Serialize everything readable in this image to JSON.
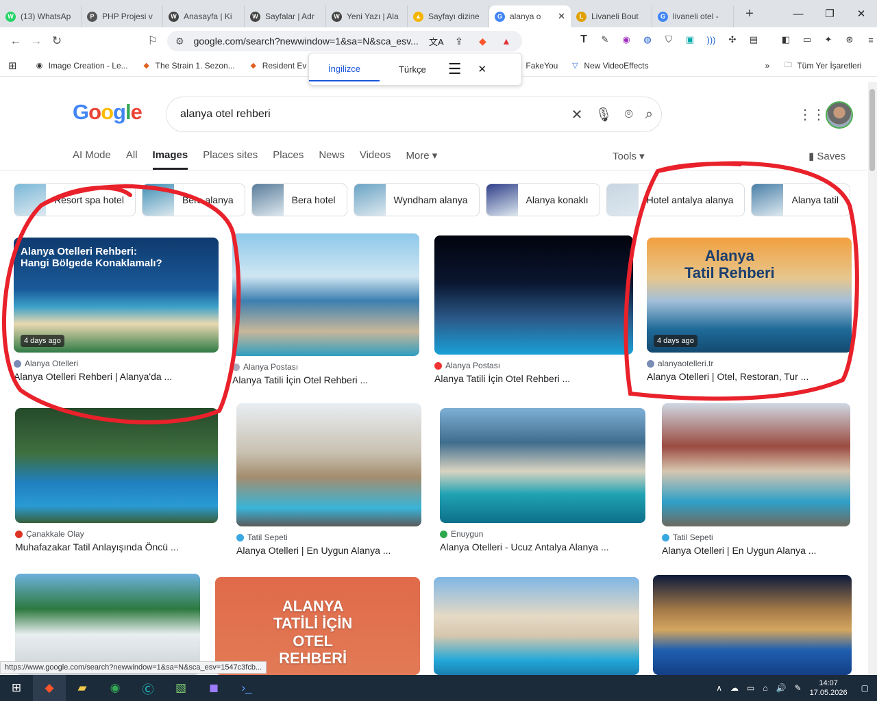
{
  "tabs": [
    {
      "title": "(13) WhatsAp",
      "color": "#25d366",
      "glyph": "W"
    },
    {
      "title": "PHP Projesi v",
      "color": "#555",
      "glyph": "P"
    },
    {
      "title": "Anasayfa | Ki",
      "color": "#444",
      "glyph": "W"
    },
    {
      "title": "Sayfalar | Adr",
      "color": "#444",
      "glyph": "W"
    },
    {
      "title": "Yeni Yazı | Ala",
      "color": "#444",
      "glyph": "W"
    },
    {
      "title": "Sayfayı dizine",
      "color": "#f4b400",
      "glyph": "▲"
    },
    {
      "title": "alanya o",
      "color": "#4285f4",
      "glyph": "G"
    },
    {
      "title": "Livaneli Bout",
      "color": "#e0a000",
      "glyph": "L"
    },
    {
      "title": "livaneli otel -",
      "color": "#4285f4",
      "glyph": "G"
    }
  ],
  "url": "google.com/search?newwindow=1&sa=N&sca_esv...",
  "bookmarks": [
    "Image Creation - Le...",
    "The Strain 1. Sezon...",
    "Resident Ev",
    "FakeYou",
    "New VideoEffects",
    "Tüm Yer İşaretleri"
  ],
  "translate": {
    "from": "İngilizce",
    "to": "Türkçe"
  },
  "logo": "Google",
  "query": "alanya otel rehberi",
  "nav": {
    "items": [
      "AI Mode",
      "All",
      "Images",
      "Places sites",
      "Places",
      "News",
      "Videos",
      "More ▾"
    ],
    "tools": "Tools ▾",
    "saves": "Saves"
  },
  "chips": [
    "Resort spa hotel",
    "Bera alanya",
    "Bera hotel",
    "Wyndham alanya",
    "Alanya konaklı",
    "Hotel antalya alanya",
    "Alanya tatil"
  ],
  "results": [
    {
      "source": "Alanya Otelleri",
      "title": "Alanya Otelleri Rehberi | Alanya'da ...",
      "badge": "4 days ago",
      "overlay": "Alanya Otelleri Rehberi:\nHangi Bölgede Konaklamalı?"
    },
    {
      "source": "Alanya Postası",
      "title": "Alanya Tatili İçin Otel Rehberi ...",
      "badge": "",
      "overlay": ""
    },
    {
      "source": "Alanya Postası",
      "title": "Alanya Tatili İçin Otel Rehberi ...",
      "badge": "",
      "overlay": ""
    },
    {
      "source": "alanyaotelleri.tr",
      "title": "Alanya Otelleri | Otel, Restoran, Tur ...",
      "badge": "4 days ago",
      "overlay": "Alanya\nTatil Rehberi"
    },
    {
      "source": "Çanakkale Olay",
      "title": "Muhafazakar Tatil Anlayışında Öncü ...",
      "badge": "",
      "overlay": ""
    },
    {
      "source": "Tatil Sepeti",
      "title": "Alanya Otelleri | En Uygun Alanya ...",
      "badge": "",
      "overlay": ""
    },
    {
      "source": "Enuygun",
      "title": "Alanya Otelleri - Ucuz Antalya Alanya ...",
      "badge": "",
      "overlay": ""
    },
    {
      "source": "Tatil Sepeti",
      "title": "Alanya Otelleri | En Uygun Alanya ...",
      "badge": "",
      "overlay": ""
    },
    {
      "source": "",
      "title": "",
      "badge": "",
      "overlay": ""
    },
    {
      "source": "",
      "title": "",
      "badge": "",
      "overlay": "ALANYA\nTATİLİ İÇİN\nOTEL\nREHBERİ"
    },
    {
      "source": "",
      "title": "",
      "badge": "",
      "overlay": ""
    },
    {
      "source": "",
      "title": "",
      "badge": "",
      "overlay": ""
    }
  ],
  "status_url": "https://www.google.com/search?newwindow=1&sa=N&sca_esv=1547c3fcb...",
  "clock": {
    "time": "14:07",
    "date": "17.05.2026"
  }
}
